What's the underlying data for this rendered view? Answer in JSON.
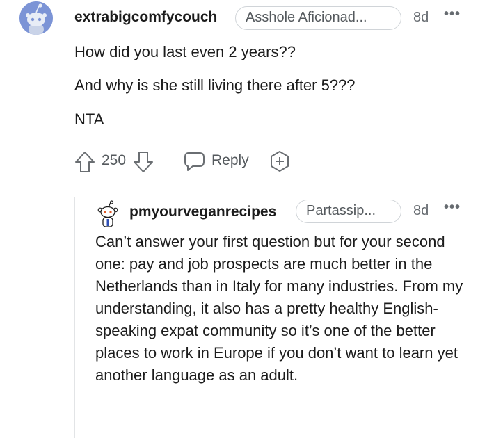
{
  "comment": {
    "username": "extrabigcomfycouch",
    "flair": "Asshole Aficionad...",
    "time": "8d",
    "more_icon": "ellipsis-icon",
    "lines": [
      "How did you last even 2 years??",
      "And why is she still living there after 5???",
      "NTA"
    ],
    "votes": "250",
    "reply_label": "Reply"
  },
  "reply": {
    "username": "pmyourveganrecipes",
    "flair": "Partassip...",
    "time": "8d",
    "more_icon": "ellipsis-icon",
    "text": "Can’t answer your first question but for your second one: pay and job prospects are much better in the Netherlands than in Italy for many industries. From my understanding, it also has a pretty healthy English-speaking expat community so it’s one of the better places to work in Europe if you don’t want to learn yet another language as an adult."
  },
  "colors": {
    "avatar_bg": "#7c94d6",
    "text": "#1c1c1c",
    "meta": "#666b70"
  }
}
